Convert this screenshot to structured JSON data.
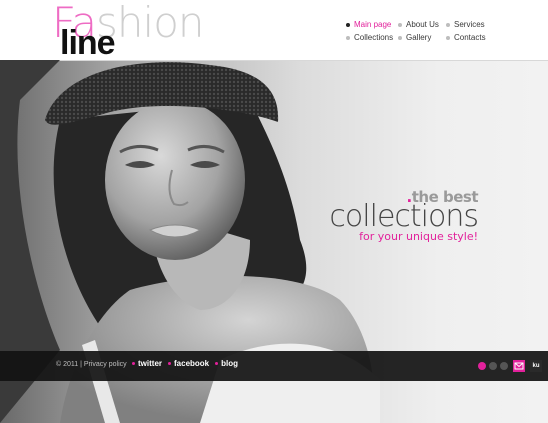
{
  "logo": {
    "first_pink": "Fa",
    "first_rest": "shion",
    "second": "line"
  },
  "nav": {
    "items": [
      {
        "label": "Main page",
        "active": true
      },
      {
        "label": "About Us",
        "active": false
      },
      {
        "label": "Services",
        "active": false
      },
      {
        "label": "Collections",
        "active": false
      },
      {
        "label": "Gallery",
        "active": false
      },
      {
        "label": "Contacts",
        "active": false
      }
    ]
  },
  "hero": {
    "tag_prefix": ".",
    "tag_best": "the best",
    "tag_collections": "collections",
    "tag_unique": "for your unique style!"
  },
  "footer": {
    "copyright": "© 2011 | Privacy policy",
    "social": [
      {
        "label": "twitter"
      },
      {
        "label": "facebook"
      },
      {
        "label": "blog"
      }
    ],
    "slider_dots": 3,
    "active_slide": 1,
    "lang_active_icon": "envelope-icon",
    "lang_other": "ku"
  },
  "colors": {
    "accent": "#e2219b",
    "logo_light": "#cfcfcf",
    "footer_bg": "#121212"
  }
}
